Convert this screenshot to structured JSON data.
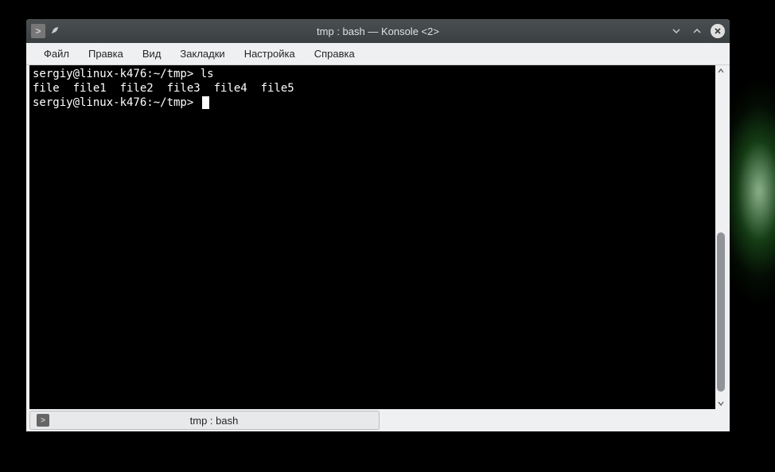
{
  "window": {
    "title": "tmp : bash — Konsole <2>"
  },
  "menubar": {
    "items": [
      "Файл",
      "Правка",
      "Вид",
      "Закладки",
      "Настройка",
      "Справка"
    ]
  },
  "terminal": {
    "lines": [
      {
        "prompt": "sergiy@linux-k476:~/tmp>",
        "command": "ls"
      },
      {
        "output": "file  file1  file2  file3  file4  file5"
      },
      {
        "prompt": "sergiy@linux-k476:~/tmp>",
        "command": "",
        "cursor": true
      }
    ]
  },
  "tab": {
    "label": "tmp : bash"
  }
}
